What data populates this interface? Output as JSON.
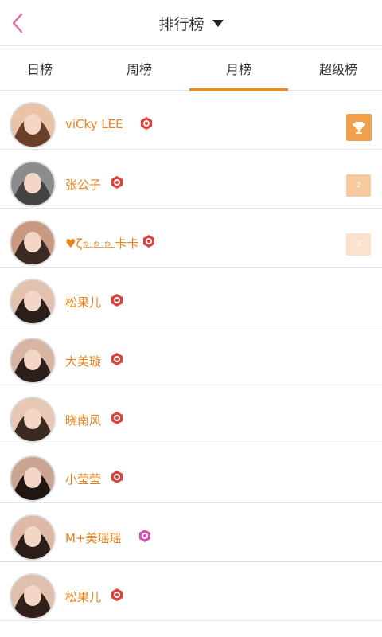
{
  "header": {
    "title": "排行榜"
  },
  "tabs": [
    {
      "label": "日榜"
    },
    {
      "label": "周榜"
    },
    {
      "label": "月榜"
    },
    {
      "label": "超级榜"
    }
  ],
  "active_tab_index": 2,
  "accent_color": "#f08a1f",
  "users": [
    {
      "name": "viCky LEE",
      "badge": "red-level-badge",
      "rank_icon": "trophy-icon"
    },
    {
      "name": "张公子",
      "badge": "red-level-badge",
      "rank_label": "2"
    },
    {
      "name": "♥ζஉஉஉ卡卡",
      "badge": "red-level-badge",
      "rank_label": "3"
    },
    {
      "name": "松果儿",
      "badge": "red-level-badge"
    },
    {
      "name": "大美璇",
      "badge": "red-level-badge"
    },
    {
      "name": "晓南风",
      "badge": "red-level-badge"
    },
    {
      "name": "小莹莹",
      "badge": "red-level-badge"
    },
    {
      "name": "M+美瑶瑶",
      "badge": "purple-level-badge"
    },
    {
      "name": "松果儿",
      "badge": "red-level-badge"
    }
  ]
}
